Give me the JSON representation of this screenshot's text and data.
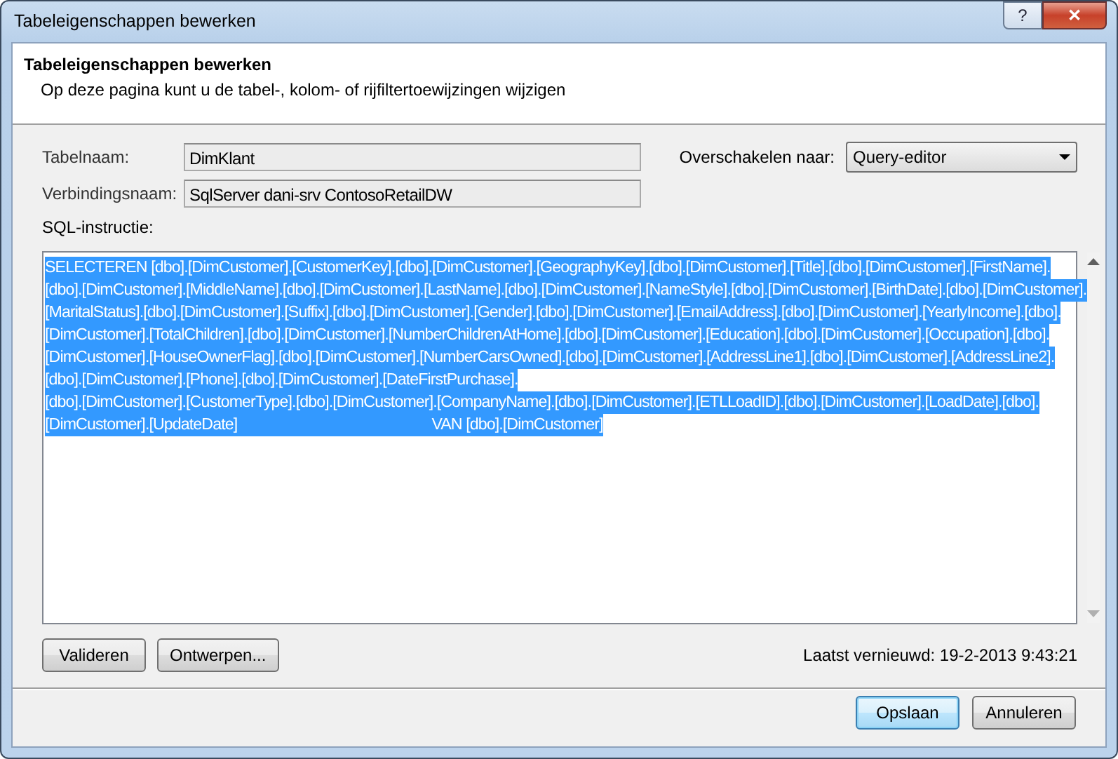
{
  "window": {
    "title": "Tabeleigenschappen bewerken",
    "help_button": "?",
    "close_button": "✕"
  },
  "header": {
    "title": "Tabeleigenschappen bewerken",
    "subtitle": "Op deze pagina kunt u de tabel-, kolom- of rijfiltertoewijzingen wijzigen"
  },
  "fields": [
    {
      "label": "Tabelnaam:",
      "value": "DimKlant"
    },
    {
      "label": "Verbindingsnaam:",
      "value": "SqlServer dani-srv ContosoRetailDW"
    }
  ],
  "switch_to": {
    "label": "Overschakelen naar:",
    "value": "Query-editor"
  },
  "sql": {
    "label": "SQL-instructie:",
    "selected": true,
    "lines": [
      "SELECTEREN [dbo].[DimCustomer].[CustomerKey].[dbo].[DimCustomer].[GeographyKey].[dbo].[DimCustomer].[Title].[dbo].[DimCustomer].[FirstName].",
      "[dbo].[DimCustomer].[MiddleName].[dbo].[DimCustomer].[LastName].[dbo].[DimCustomer].[NameStyle].[dbo].[DimCustomer].[BirthDate].[dbo].[DimCustomer].",
      "[MaritalStatus].[dbo].[DimCustomer].[Suffix].[dbo].[DimCustomer].[Gender].[dbo].[DimCustomer].[EmailAddress].[dbo].[DimCustomer].[YearlyIncome].[dbo].",
      "[DimCustomer].[TotalChildren].[dbo].[DimCustomer].[NumberChildrenAtHome].[dbo].[DimCustomer].[Education].[dbo].[DimCustomer].[Occupation].[dbo].",
      "[DimCustomer].[HouseOwnerFlag].[dbo].[DimCustomer].[NumberCarsOwned].[dbo].[DimCustomer].[AddressLine1].[dbo].[DimCustomer].[AddressLine2].",
      "[dbo].[DimCustomer].[Phone].[dbo].[DimCustomer].[DateFirstPurchase].",
      "[dbo].[DimCustomer].[CustomerType].[dbo].[DimCustomer].[CompanyName].[dbo].[DimCustomer].[ETLLoadID].[dbo].[DimCustomer].[LoadDate].[dbo].",
      "[DimCustomer].[UpdateDate]                                                  VAN [dbo].[DimCustomer]"
    ]
  },
  "actions": [
    "Valideren",
    "Ontwerpen..."
  ],
  "last_refreshed": "Laatst vernieuwd: 19-2-2013 9:43:21",
  "buttons": [
    {
      "label": "Opslaan",
      "default": true
    },
    {
      "label": "Annuleren",
      "default": false
    }
  ]
}
